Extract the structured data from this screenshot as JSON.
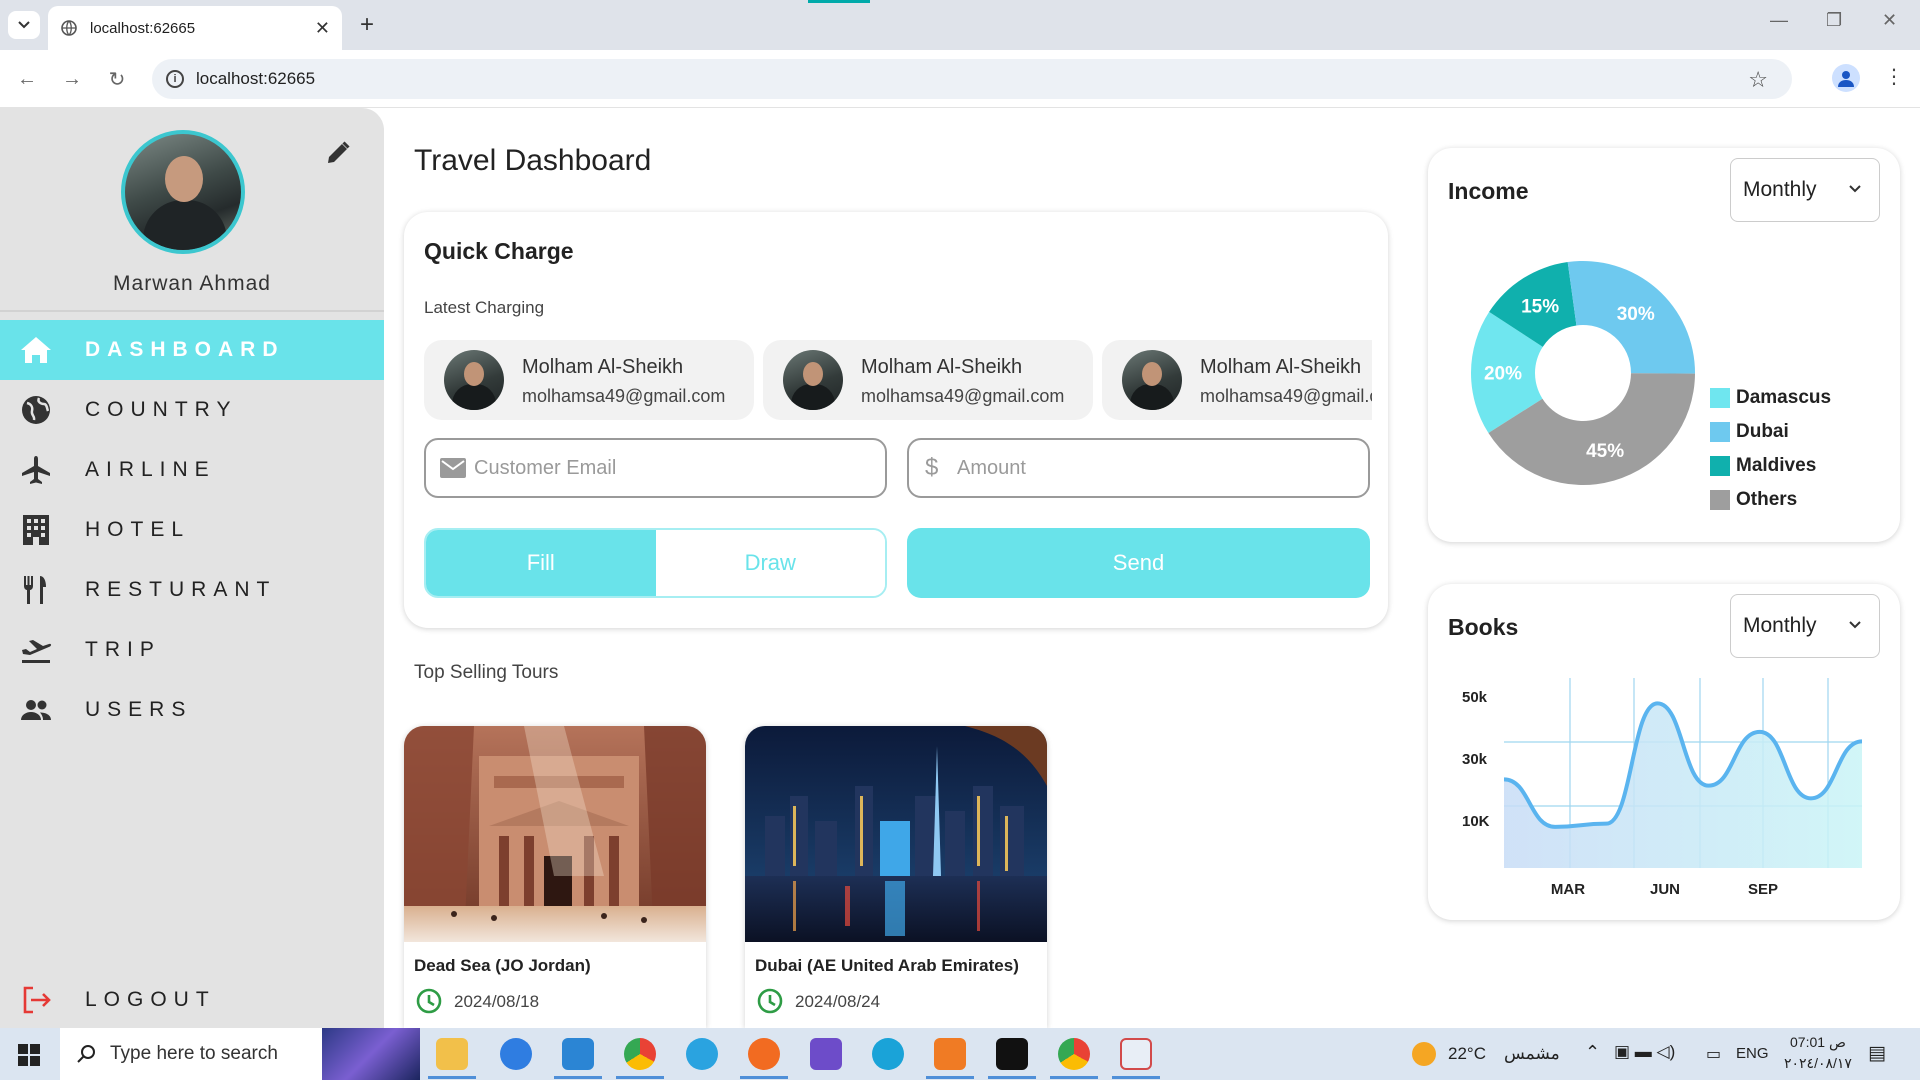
{
  "browser": {
    "tab_title": "localhost:62665",
    "url": "localhost:62665"
  },
  "sidebar": {
    "user_name": "Marwan Ahmad",
    "items": [
      {
        "label": "DASHBOARD",
        "icon": "home-icon",
        "active": true
      },
      {
        "label": "COUNTRY",
        "icon": "globe-icon"
      },
      {
        "label": "AIRLINE",
        "icon": "airplane-icon"
      },
      {
        "label": "HOTEL",
        "icon": "hotel-icon"
      },
      {
        "label": "RESTURANT",
        "icon": "restaurant-icon"
      },
      {
        "label": "TRIP",
        "icon": "flight-takeoff-icon"
      },
      {
        "label": "USERS",
        "icon": "users-icon"
      }
    ],
    "logout_label": "LOGOUT"
  },
  "main": {
    "title": "Travel Dashboard",
    "quick_charge": {
      "title": "Quick Charge",
      "subtitle": "Latest Charging",
      "recent": [
        {
          "name": "Molham Al-Sheikh",
          "email": "molhamsa49@gmail.com"
        },
        {
          "name": "Molham Al-Sheikh",
          "email": "molhamsa49@gmail.com"
        },
        {
          "name": "Molham Al-Sheikh",
          "email": "molhamsa49@gmail.com"
        }
      ],
      "email_placeholder": "Customer Email",
      "amount_placeholder": "Amount",
      "fill_label": "Fill",
      "draw_label": "Draw",
      "send_label": "Send"
    },
    "tours_title": "Top Selling Tours",
    "tours": [
      {
        "name": "Dead Sea (JO    Jordan)",
        "date": "2024/08/18"
      },
      {
        "name": "Dubai (AE    United Arab Emirates)",
        "date": "2024/08/24"
      }
    ]
  },
  "income": {
    "title": "Income",
    "period": "Monthly",
    "chart_data": {
      "type": "pie",
      "categories": [
        "Damascus",
        "Dubai",
        "Maldives",
        "Others"
      ],
      "values": [
        20,
        30,
        15,
        45
      ],
      "labels": [
        "20%",
        "30%",
        "15%",
        "45%"
      ],
      "colors": [
        "#6fe6ef",
        "#6ec9ef",
        "#10b0ad",
        "#9e9e9e"
      ],
      "legend": "right"
    }
  },
  "books": {
    "title": "Books",
    "period": "Monthly",
    "chart_data": {
      "type": "area",
      "x": [
        "",
        "MAR",
        "",
        "JUN",
        "",
        "SEP",
        ""
      ],
      "xticks": [
        "MAR",
        "JUN",
        "SEP"
      ],
      "yticks": [
        "50k",
        "30k",
        "10K"
      ],
      "grid": true,
      "series": [
        {
          "values": [
            28,
            13,
            14,
            52,
            26,
            43,
            22,
            40
          ]
        }
      ],
      "color": "#5ab4ef"
    }
  },
  "taskbar": {
    "search_placeholder": "Type here to search",
    "weather_temp": "22°C",
    "weather_text": "مشمس",
    "lang": "ENG",
    "time": "07:01 ص",
    "date": "٢٠٢٤/٠٨/١٧"
  }
}
